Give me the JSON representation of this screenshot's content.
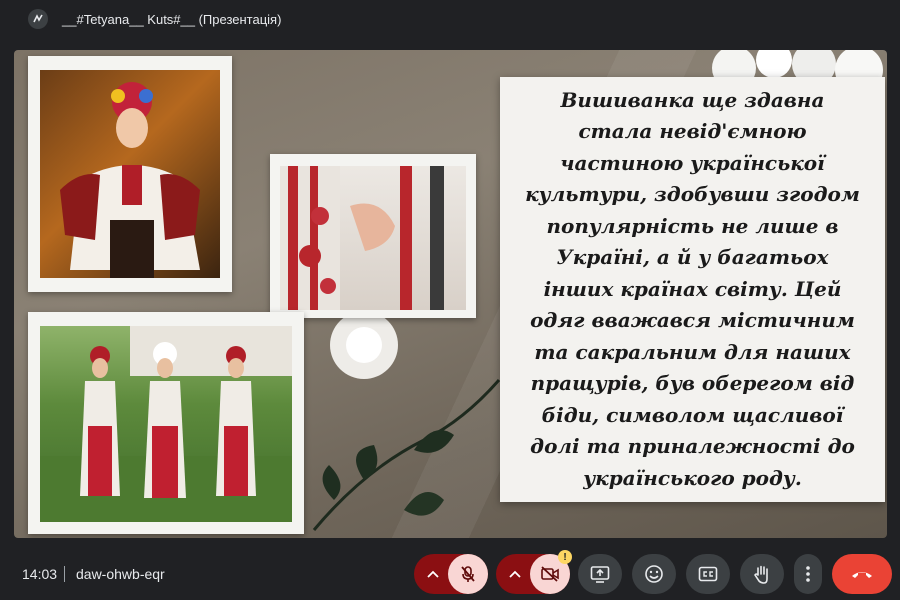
{
  "header": {
    "title": "__#Tetyana__ Kuts#__ (Презентація)"
  },
  "slide": {
    "body_text": "Вишиванка ще здавна стала невід'ємною частиною української культури, здобувши згодом популярність не лише в Україні, а й у багатьох інших країнах світу. Цей одяг вважався містичним та сакральним для наших пращурів, був оберегом від біди, символом щасливої долі та приналежності до українського роду."
  },
  "footer": {
    "time": "14:03",
    "meeting_code": "daw-ohwb-eqr"
  },
  "colors": {
    "bar": "#202124",
    "mic_off": "#f9d6d4",
    "danger": "#ea4335",
    "button": "#3c4043"
  },
  "icons": [
    "meet-logo-icon",
    "chevron-up-icon",
    "mic-off-icon",
    "camera-off-icon",
    "warning-icon",
    "present-icon",
    "emoji-icon",
    "captions-icon",
    "raise-hand-icon",
    "more-options-icon",
    "end-call-icon"
  ]
}
